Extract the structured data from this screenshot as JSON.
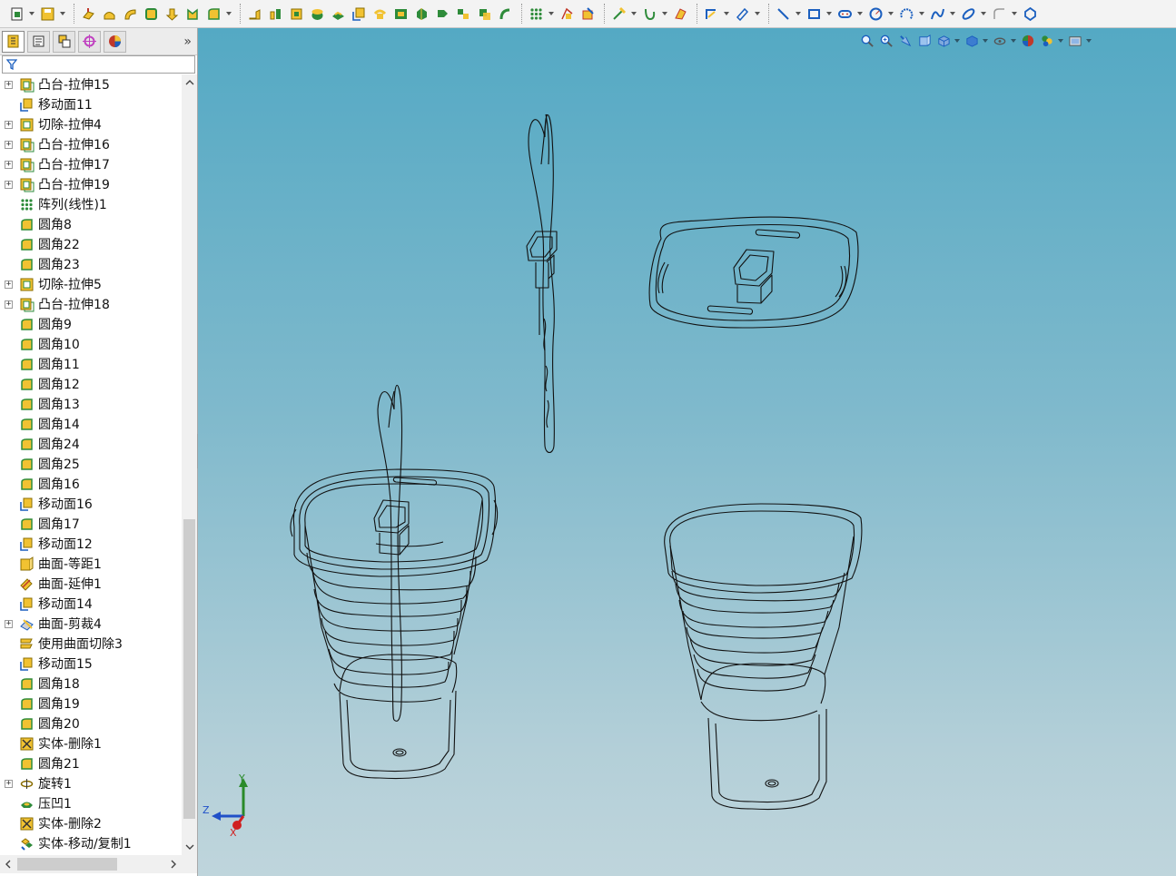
{
  "toolbar": {
    "buttons": [
      {
        "name": "new-doc-icon",
        "dropdown": true
      },
      {
        "name": "save-icon",
        "dropdown": true
      },
      {
        "name": "sep"
      },
      {
        "name": "extruded-boss-icon"
      },
      {
        "name": "revolved-boss-icon"
      },
      {
        "name": "swept-boss-icon"
      },
      {
        "name": "lofted-boss-icon"
      },
      {
        "name": "extruded-cut-icon"
      },
      {
        "name": "revolved-cut-icon"
      },
      {
        "name": "fillet-icon",
        "dropdown": true
      },
      {
        "name": "sep"
      },
      {
        "name": "rib-icon"
      },
      {
        "name": "shell-icon"
      },
      {
        "name": "draft-icon"
      },
      {
        "name": "dome-icon"
      },
      {
        "name": "wrap-icon"
      },
      {
        "name": "move-face-icon"
      },
      {
        "name": "hole-icon"
      },
      {
        "name": "thicken-icon"
      },
      {
        "name": "solid-move-icon"
      },
      {
        "name": "split-icon"
      },
      {
        "name": "combine-icon"
      },
      {
        "name": "intersect-icon"
      },
      {
        "name": "mirror-icon"
      },
      {
        "name": "sep"
      },
      {
        "name": "linear-pattern-icon",
        "dropdown": true
      },
      {
        "name": "curve-icon"
      },
      {
        "name": "instant3d-icon"
      },
      {
        "name": "sep"
      },
      {
        "name": "reference-point-icon",
        "dropdown": true
      },
      {
        "name": "helix-icon",
        "dropdown": true
      },
      {
        "name": "surface-icon"
      },
      {
        "name": "sep"
      },
      {
        "name": "sketch-icon",
        "dropdown": true
      },
      {
        "name": "smart-dimension-icon",
        "dropdown": true
      },
      {
        "name": "sep"
      },
      {
        "name": "line-icon",
        "dropdown": true
      },
      {
        "name": "rectangle-icon",
        "dropdown": true
      },
      {
        "name": "slot-icon",
        "dropdown": true
      },
      {
        "name": "circle-icon",
        "dropdown": true
      },
      {
        "name": "arc-icon",
        "dropdown": true
      },
      {
        "name": "spline-icon",
        "dropdown": true
      },
      {
        "name": "ellipse-icon",
        "dropdown": true
      },
      {
        "name": "sketch-fillet-icon",
        "dropdown": true
      },
      {
        "name": "polygon-icon"
      }
    ]
  },
  "panel": {
    "tabs": [
      {
        "name": "feature-manager-icon",
        "active": true
      },
      {
        "name": "property-manager-icon"
      },
      {
        "name": "configuration-manager-icon"
      },
      {
        "name": "dimxpert-icon"
      },
      {
        "name": "display-manager-icon"
      }
    ],
    "expand_glyph": "»",
    "filter_icon": "filter-icon"
  },
  "tree": {
    "items": [
      {
        "label": "凸台-拉伸15",
        "icon": "boss-extrude-icon",
        "expandable": true
      },
      {
        "label": "移动面11",
        "icon": "move-face-icon",
        "expandable": false
      },
      {
        "label": "切除-拉伸4",
        "icon": "cut-extrude-icon",
        "expandable": true
      },
      {
        "label": "凸台-拉伸16",
        "icon": "boss-extrude-icon",
        "expandable": true
      },
      {
        "label": "凸台-拉伸17",
        "icon": "boss-extrude-icon",
        "expandable": true
      },
      {
        "label": "凸台-拉伸19",
        "icon": "boss-extrude-icon",
        "expandable": true
      },
      {
        "label": "阵列(线性)1",
        "icon": "linear-pattern-icon",
        "expandable": false
      },
      {
        "label": "圆角8",
        "icon": "fillet-icon",
        "expandable": false
      },
      {
        "label": "圆角22",
        "icon": "fillet-icon",
        "expandable": false
      },
      {
        "label": "圆角23",
        "icon": "fillet-icon",
        "expandable": false
      },
      {
        "label": "切除-拉伸5",
        "icon": "cut-extrude-icon",
        "expandable": true
      },
      {
        "label": "凸台-拉伸18",
        "icon": "boss-extrude-icon",
        "expandable": true
      },
      {
        "label": "圆角9",
        "icon": "fillet-icon",
        "expandable": false
      },
      {
        "label": "圆角10",
        "icon": "fillet-icon",
        "expandable": false
      },
      {
        "label": "圆角11",
        "icon": "fillet-icon",
        "expandable": false
      },
      {
        "label": "圆角12",
        "icon": "fillet-icon",
        "expandable": false
      },
      {
        "label": "圆角13",
        "icon": "fillet-icon",
        "expandable": false
      },
      {
        "label": "圆角14",
        "icon": "fillet-icon",
        "expandable": false
      },
      {
        "label": "圆角24",
        "icon": "fillet-icon",
        "expandable": false
      },
      {
        "label": "圆角25",
        "icon": "fillet-icon",
        "expandable": false
      },
      {
        "label": "圆角16",
        "icon": "fillet-icon",
        "expandable": false
      },
      {
        "label": "移动面16",
        "icon": "move-face-icon",
        "expandable": false
      },
      {
        "label": "圆角17",
        "icon": "fillet-icon",
        "expandable": false
      },
      {
        "label": "移动面12",
        "icon": "move-face-icon",
        "expandable": false
      },
      {
        "label": "曲面-等距1",
        "icon": "offset-surface-icon",
        "expandable": false
      },
      {
        "label": "曲面-延伸1",
        "icon": "extend-surface-icon",
        "expandable": false
      },
      {
        "label": "移动面14",
        "icon": "move-face-icon",
        "expandable": false
      },
      {
        "label": "曲面-剪裁4",
        "icon": "trim-surface-icon",
        "expandable": true
      },
      {
        "label": "使用曲面切除3",
        "icon": "surface-cut-icon",
        "expandable": false
      },
      {
        "label": "移动面15",
        "icon": "move-face-icon",
        "expandable": false
      },
      {
        "label": "圆角18",
        "icon": "fillet-icon",
        "expandable": false
      },
      {
        "label": "圆角19",
        "icon": "fillet-icon",
        "expandable": false
      },
      {
        "label": "圆角20",
        "icon": "fillet-icon",
        "expandable": false
      },
      {
        "label": "实体-删除1",
        "icon": "delete-body-icon",
        "expandable": false
      },
      {
        "label": "圆角21",
        "icon": "fillet-icon",
        "expandable": false
      },
      {
        "label": "旋转1",
        "icon": "revolve-icon",
        "expandable": true
      },
      {
        "label": "压凹1",
        "icon": "indent-icon",
        "expandable": false
      },
      {
        "label": "实体-删除2",
        "icon": "delete-body-icon",
        "expandable": false
      },
      {
        "label": "实体-移动/复制1",
        "icon": "move-copy-body-icon",
        "expandable": false
      }
    ]
  },
  "heads_up": {
    "buttons": [
      {
        "name": "zoom-to-fit-icon"
      },
      {
        "name": "zoom-to-area-icon"
      },
      {
        "name": "previous-view-icon"
      },
      {
        "name": "section-view-icon"
      },
      {
        "name": "view-orientation-icon",
        "dropdown": true
      },
      {
        "name": "display-style-icon",
        "dropdown": true
      },
      {
        "name": "hide-show-items-icon",
        "dropdown": true
      },
      {
        "name": "edit-appearance-icon"
      },
      {
        "name": "apply-scene-icon",
        "dropdown": true
      },
      {
        "name": "view-settings-icon",
        "dropdown": true
      }
    ]
  },
  "triad": {
    "x_label": "X",
    "y_label": "Y",
    "z_label": "Z",
    "x_color": "#d02020",
    "y_color": "#2a8a2a",
    "z_color": "#2050c8"
  },
  "colors": {
    "viewport_top": "#54a9c4",
    "viewport_bottom": "#bfd5dc",
    "edge": "#111111"
  }
}
